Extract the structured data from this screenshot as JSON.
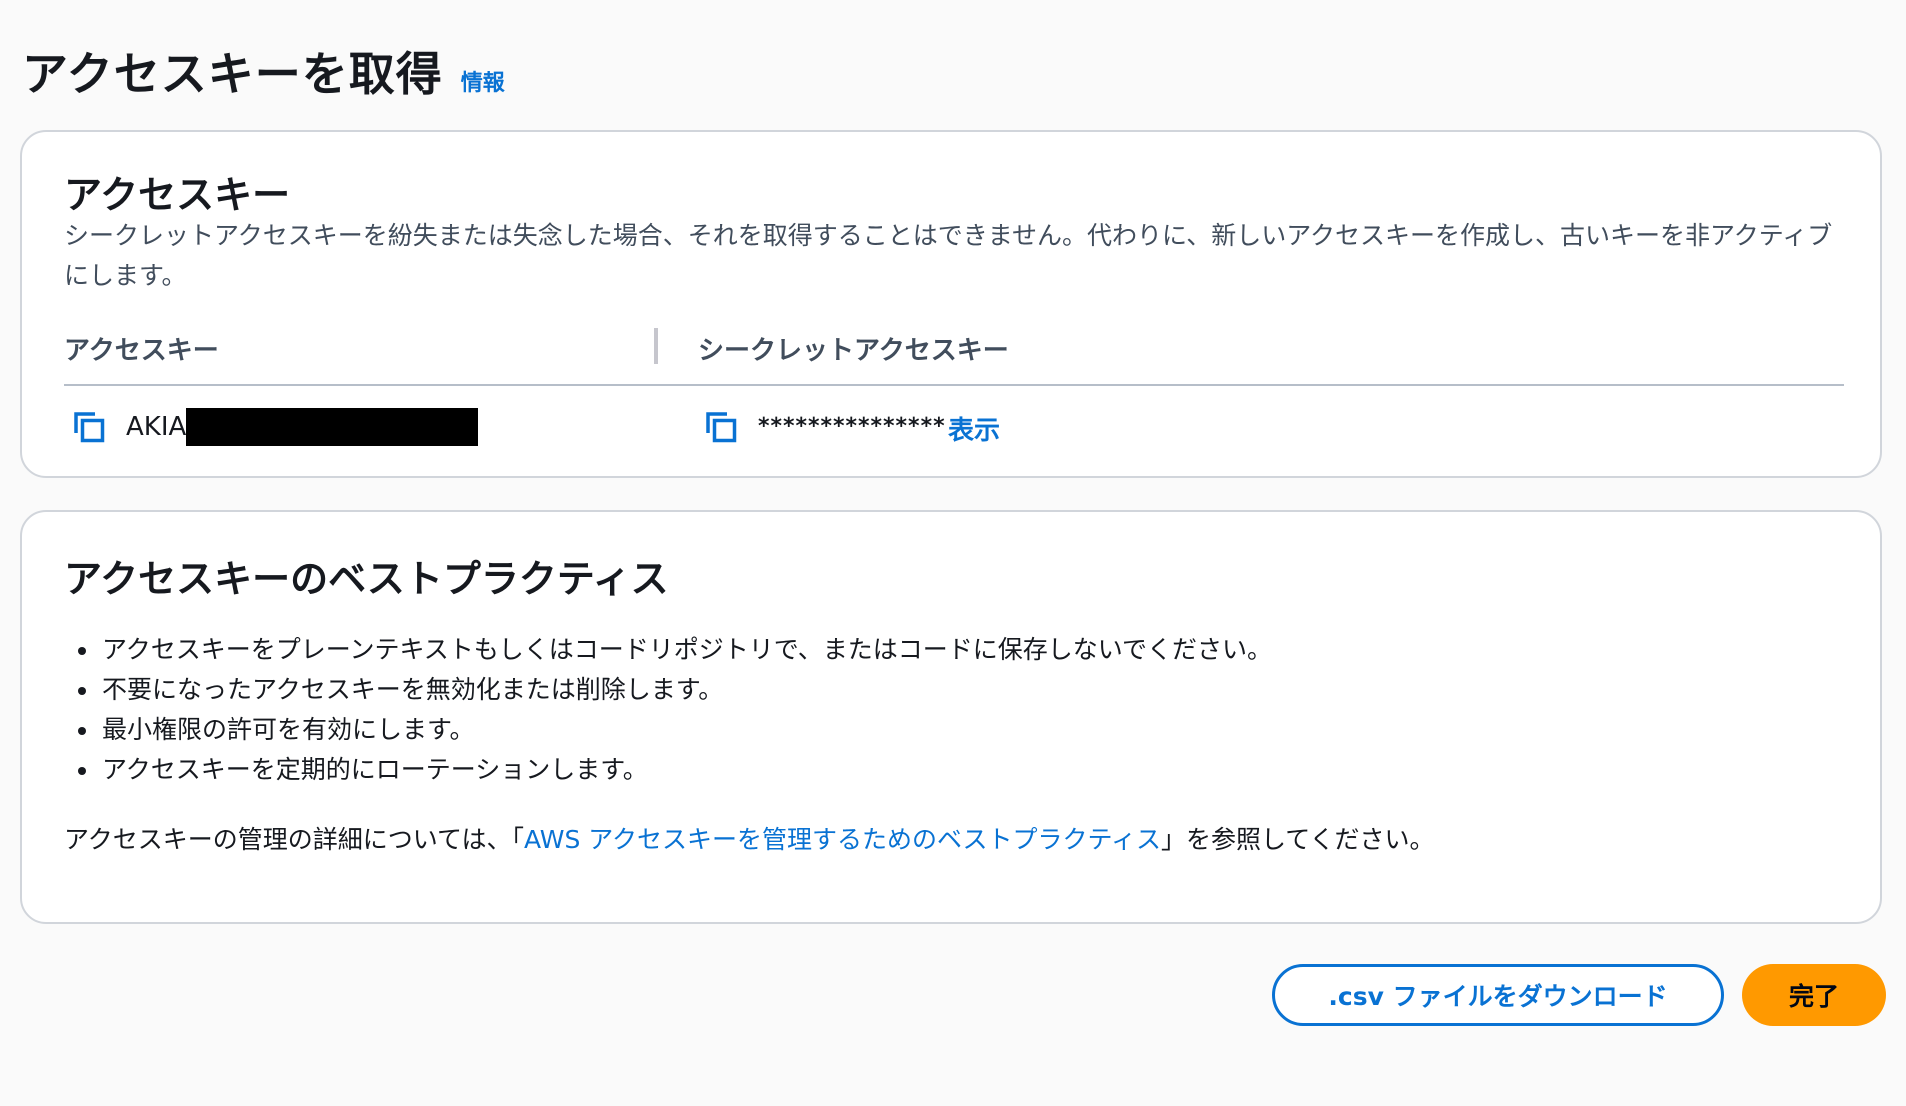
{
  "header": {
    "title": "アクセスキーを取得",
    "info_link": "情報"
  },
  "access_key_panel": {
    "title": "アクセスキー",
    "description": "シークレットアクセスキーを紛失または失念した場合、それを取得することはできません。代わりに、新しいアクセスキーを作成し、古いキーを非アクティブにします。",
    "columns": [
      "アクセスキー",
      "シークレットアクセスキー"
    ],
    "access_key_prefix": "AKIA",
    "secret_masked": "***************",
    "show_link": "表示"
  },
  "best_practices_panel": {
    "title": "アクセスキーのベストプラクティス",
    "items": [
      "アクセスキーをプレーンテキストもしくはコードリポジトリで、またはコードに保存しないでください。",
      "不要になったアクセスキーを無効化または削除します。",
      "最小権限の許可を有効にします。",
      "アクセスキーを定期的にローテーションします。"
    ],
    "footer_prefix": "アクセスキーの管理の詳細については、「",
    "footer_link": "AWS アクセスキーを管理するためのベストプラクティス",
    "footer_suffix": "」を参照してください。"
  },
  "actions": {
    "download_csv": ".csv ファイルをダウンロード",
    "done": "完了"
  },
  "colors": {
    "link": "#0972d3",
    "primary_button": "#ff9900",
    "panel_border": "#d1d5db",
    "background": "#fafafa"
  },
  "icons": [
    "copy-icon"
  ]
}
